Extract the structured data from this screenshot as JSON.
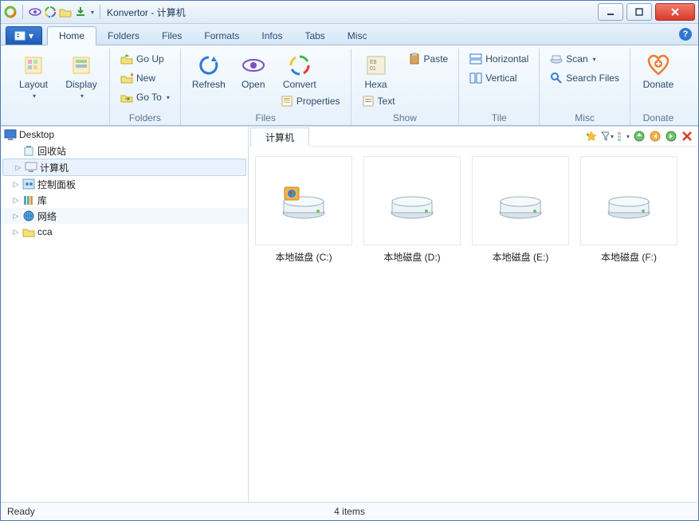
{
  "window": {
    "title": "Konvertor - 计算机"
  },
  "tabs": {
    "file_caret": "▾",
    "items": [
      "Home",
      "Folders",
      "Files",
      "Formats",
      "Infos",
      "Tabs",
      "Misc"
    ],
    "active": 0,
    "help": "?"
  },
  "ribbon": {
    "groups": {
      "g0": {
        "label": "",
        "layout": {
          "label": "Layout",
          "caret": "▾"
        },
        "display": {
          "label": "Display",
          "caret": "▾"
        }
      },
      "folders": {
        "label": "Folders",
        "go_up": "Go Up",
        "new": "New",
        "go_to": "Go To",
        "caret": "▾"
      },
      "files": {
        "label": "Files",
        "refresh": "Refresh",
        "open": "Open",
        "convert": "Convert",
        "properties": "Properties"
      },
      "show": {
        "label": "Show",
        "hexa": "Hexa",
        "paste": "Paste",
        "text": "Text"
      },
      "tile": {
        "label": "Tile",
        "horizontal": "Horizontal",
        "vertical": "Vertical"
      },
      "misc": {
        "label": "Misc",
        "scan": "Scan",
        "caret": "▾",
        "search": "Search Files"
      },
      "donate": {
        "label": "Donate",
        "btn": "Donate"
      }
    }
  },
  "tree": {
    "root": "Desktop",
    "nodes": [
      {
        "label": "回收站",
        "icon": "recycle",
        "expandable": false
      },
      {
        "label": "计算机",
        "icon": "computer",
        "expandable": true,
        "selected": true
      },
      {
        "label": "控制面板",
        "icon": "control",
        "expandable": true
      },
      {
        "label": "库",
        "icon": "library",
        "expandable": true
      },
      {
        "label": "网络",
        "icon": "network",
        "expandable": true,
        "highlight": true
      },
      {
        "label": "cca",
        "icon": "folder",
        "expandable": true
      }
    ]
  },
  "content": {
    "breadcrumb": "计算机",
    "items": [
      {
        "label": "本地磁盘 (C:)",
        "system": true
      },
      {
        "label": "本地磁盘 (D:)",
        "system": false
      },
      {
        "label": "本地磁盘 (E:)",
        "system": false
      },
      {
        "label": "本地磁盘 (F:)",
        "system": false
      }
    ]
  },
  "status": {
    "left": "Ready",
    "center": "4 items"
  }
}
